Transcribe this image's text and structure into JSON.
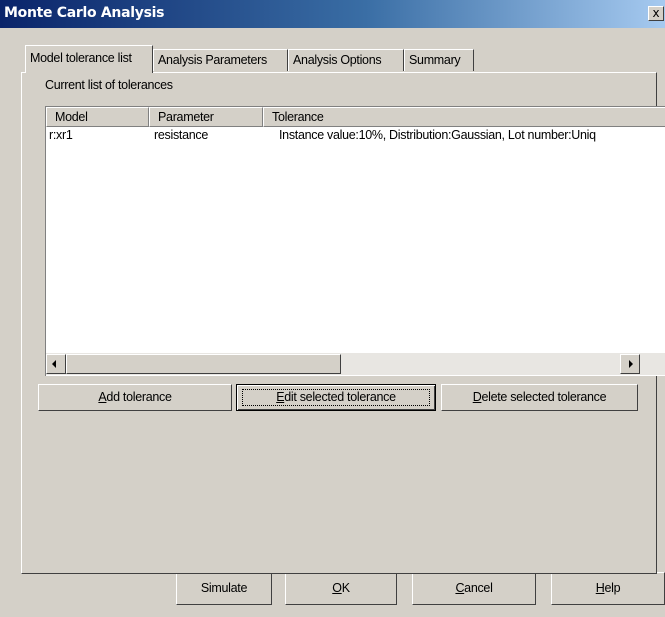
{
  "window": {
    "title": "Monte Carlo Analysis",
    "close_glyph": "x"
  },
  "tabs": [
    {
      "label": "Model tolerance list",
      "active": true
    },
    {
      "label": "Analysis Parameters"
    },
    {
      "label": "Analysis Options"
    },
    {
      "label": "Summary"
    }
  ],
  "group": {
    "label": "Current list of tolerances"
  },
  "table": {
    "columns": [
      "Model",
      "Parameter",
      "Tolerance"
    ],
    "rows": [
      {
        "model": "r:xr1",
        "parameter": "resistance",
        "tolerance": "Instance value:10%, Distribution:Gaussian, Lot number:Uniq"
      }
    ]
  },
  "scrollbar": {
    "left_icon": "arrow-left-icon",
    "right_icon": "arrow-right-icon"
  },
  "actions": {
    "add": {
      "mnemonic": "A",
      "rest": "dd tolerance"
    },
    "edit": {
      "mnemonic": "E",
      "rest": "dit selected tolerance"
    },
    "delete": {
      "mnemonic": "D",
      "rest": "elete selected tolerance"
    }
  },
  "footer": {
    "simulate": {
      "label": "Simulate"
    },
    "ok": {
      "mnemonic": "O",
      "rest": "K"
    },
    "cancel": {
      "mnemonic": "C",
      "rest": "ancel"
    },
    "help": {
      "mnemonic": "H",
      "rest": "elp"
    }
  }
}
